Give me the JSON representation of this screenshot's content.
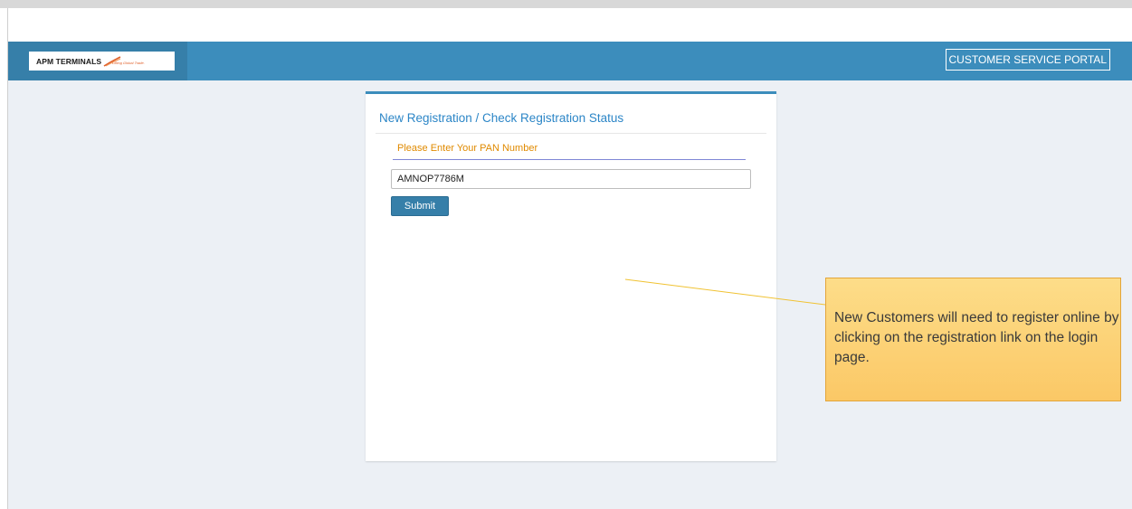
{
  "header": {
    "logo_text": "APM TERMINALS",
    "logo_tagline": "Lifting Global Trade.",
    "portal_label": "CUSTOMER SERVICE PORTAL",
    "accent_color": "#3c8dbc"
  },
  "registration": {
    "title": "New Registration / Check Registration Status",
    "pan_label": "Please Enter Your PAN Number",
    "pan_value": "AMNOP7786M",
    "submit_label": "Submit"
  },
  "callout": {
    "text": "New Customers will need to register online by clicking on the registration link on the login page."
  }
}
